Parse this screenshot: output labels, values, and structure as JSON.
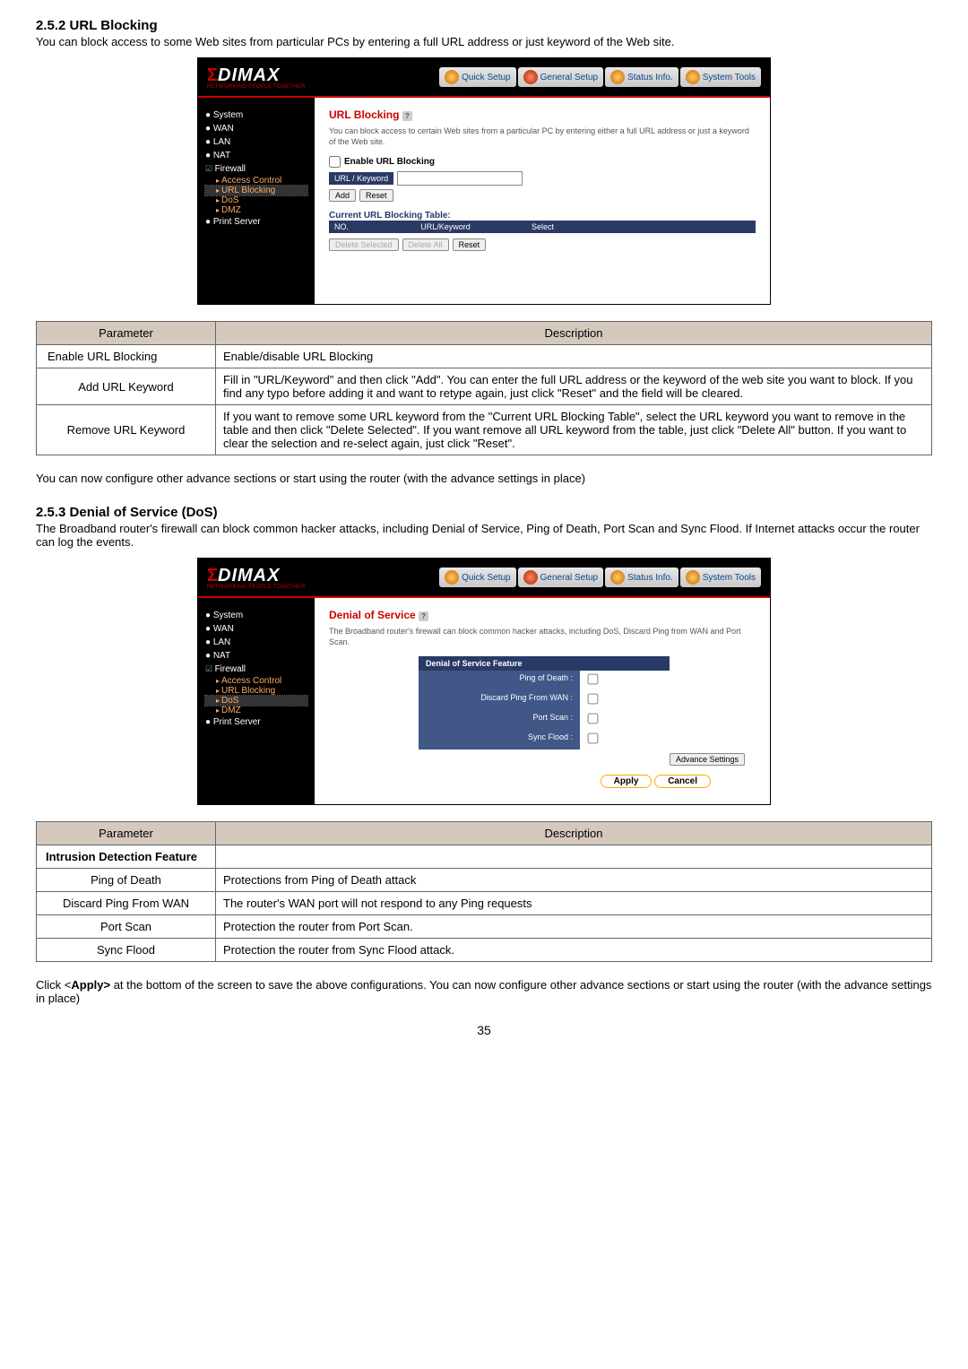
{
  "section1": {
    "number": "2.5.2",
    "title": "URL Blocking",
    "intro": "You can block access to some Web sites from particular PCs by entering a full URL address or just keyword of the Web site."
  },
  "screenshot1": {
    "logo_sub": "NETWORKING PEOPLE TOGETHER",
    "nav": {
      "quick": "Quick Setup",
      "general": "General Setup",
      "status": "Status Info.",
      "tools": "System Tools"
    },
    "sidebar": {
      "system": "System",
      "wan": "WAN",
      "lan": "LAN",
      "nat": "NAT",
      "firewall": "Firewall",
      "access": "Access Control",
      "url": "URL Blocking",
      "dos": "DoS",
      "dmz": "DMZ",
      "print": "Print Server"
    },
    "content": {
      "title": "URL Blocking",
      "desc": "You can block access to certain Web sites from a particular PC by entering either a full URL address or just a keyword of the Web site.",
      "enable_cb": "Enable URL Blocking",
      "url_kw": "URL / Keyword",
      "add": "Add",
      "reset": "Reset",
      "table_title": "Current URL Blocking Table:",
      "th_no": "NO.",
      "th_urlkw": "URL/Keyword",
      "th_select": "Select",
      "del_sel": "Delete Selected",
      "del_all": "Delete All"
    }
  },
  "table1": {
    "h_param": "Parameter",
    "h_desc": "Description",
    "rows": [
      {
        "p": "Enable URL Blocking",
        "d": "Enable/disable URL Blocking"
      },
      {
        "p": "Add URL Keyword",
        "d": "Fill in \"URL/Keyword\" and then click \"Add\". You can enter the full URL address or the keyword of the web site you want to block. If you find any typo before adding it and want to retype again, just click \"Reset\" and the field will be cleared."
      },
      {
        "p": "Remove URL Keyword",
        "d": "If you want to remove some URL keyword from the \"Current URL Blocking Table\", select the URL keyword you want to remove in the table and then click \"Delete Selected\". If you want remove all URL keyword from the table, just click \"Delete All\" button. If you want to clear the selection and re-select again, just click \"Reset\"."
      }
    ]
  },
  "after1": "You can now configure other advance sections or start using the router (with the advance settings in place)",
  "section2": {
    "number": "2.5.3",
    "title": "Denial of Service (DoS)",
    "intro1": "The Broadband router's firewall can block common hacker attacks, including Denial of Service, Ping of Death, Port Scan and Sync Flood.",
    "intro2": "If Internet attacks occur the router can log the events."
  },
  "screenshot2": {
    "content": {
      "title": "Denial of Service",
      "desc": "The Broadband router's firewall can block common hacker attacks, including DoS, Discard Ping from WAN and Port Scan.",
      "feature_title": "Denial of Service Feature",
      "ping_death": "Ping of Death :",
      "discard_wan": "Discard Ping From WAN :",
      "port_scan": "Port Scan :",
      "sync_flood": "Sync Flood :",
      "adv": "Advance Settings",
      "apply": "Apply",
      "cancel": "Cancel"
    }
  },
  "table2": {
    "h_param": "Parameter",
    "h_desc": "Description",
    "header_row": "Intrusion Detection Feature",
    "rows": [
      {
        "p": "Ping of Death",
        "d": "Protections from Ping of Death attack"
      },
      {
        "p": "Discard Ping From WAN",
        "d": "The router's WAN port will not respond to any Ping requests"
      },
      {
        "p": "Port Scan",
        "d": "Protection the router from Port Scan."
      },
      {
        "p": "Sync Flood",
        "d": "Protection the router from Sync Flood attack."
      }
    ]
  },
  "after2_pre": "Click <",
  "after2_bold": "Apply>",
  "after2_post": " at the bottom of the screen to save the above configurations. You can now configure other advance sections or start using the router (with the advance settings in place)",
  "page": "35"
}
